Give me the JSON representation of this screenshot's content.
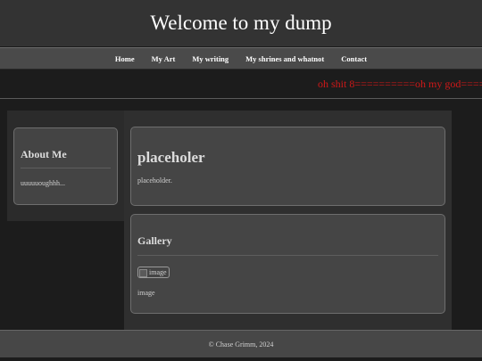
{
  "header": {
    "title": "Welcome to my dump"
  },
  "nav": {
    "items": [
      {
        "label": "Home"
      },
      {
        "label": "My Art"
      },
      {
        "label": "My writing"
      },
      {
        "label": "My shrines and whatnot"
      },
      {
        "label": "Contact"
      }
    ]
  },
  "marquee": {
    "text": "oh shit 8==========oh my god====",
    "color": "#d01818"
  },
  "sidebar": {
    "about": {
      "title": "About Me",
      "text": "uuuuuoughhh..."
    }
  },
  "main": {
    "placeholder_card": {
      "title": "placeholer",
      "text": "placeholder."
    },
    "gallery_card": {
      "title": "Gallery",
      "image_alt": "image",
      "caption": "image"
    }
  },
  "footer": {
    "text": "© Chase Grimm, 2024"
  }
}
